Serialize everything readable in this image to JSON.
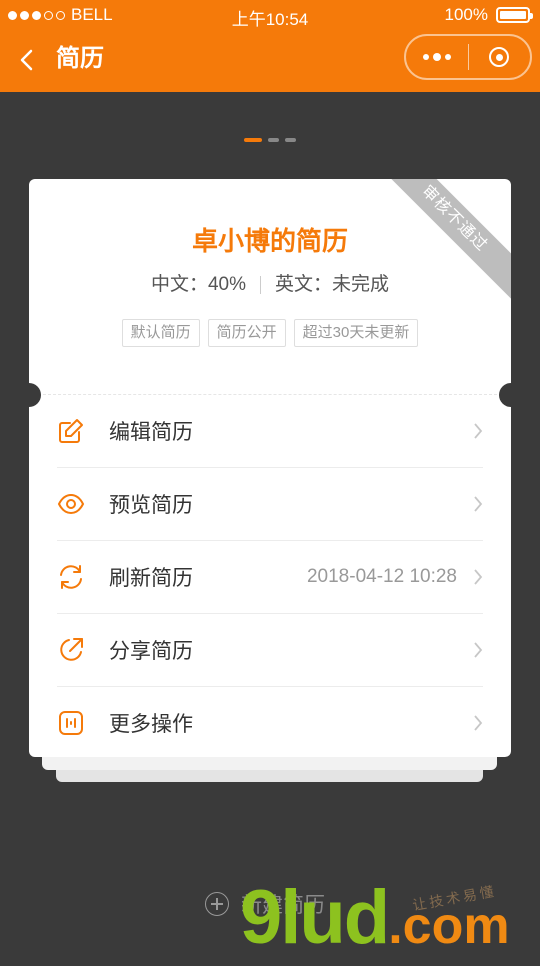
{
  "status_bar": {
    "carrier": "BELL",
    "time": "上午10:54",
    "battery": "100%"
  },
  "nav": {
    "title": "简历"
  },
  "pager": {
    "count": 3,
    "active_index": 0
  },
  "resume_card": {
    "status_ribbon": "审核不通过",
    "title": "卓小博的简历",
    "chinese_progress": "中文：40%",
    "english_progress": "英文：未完成",
    "tags": [
      "默认简历",
      "简历公开",
      "超过30天未更新"
    ],
    "menu": [
      {
        "label": "编辑简历",
        "icon": "edit-icon",
        "extra": ""
      },
      {
        "label": "预览简历",
        "icon": "eye-icon",
        "extra": ""
      },
      {
        "label": "刷新简历",
        "icon": "refresh-icon",
        "extra": "2018-04-12 10:28"
      },
      {
        "label": "分享简历",
        "icon": "share-icon",
        "extra": ""
      },
      {
        "label": "更多操作",
        "icon": "more-actions-icon",
        "extra": ""
      }
    ]
  },
  "new_resume_label": "新建简历",
  "watermark": {
    "main": "9lud",
    "suffix": ".com",
    "small": "让技术易懂"
  },
  "colors": {
    "accent": "#f57a0a",
    "background": "#3a3a3a",
    "ribbon": "#bdbdbd"
  }
}
